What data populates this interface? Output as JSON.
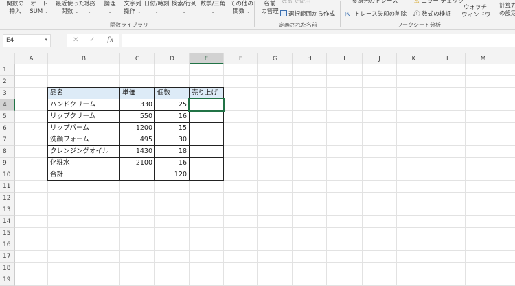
{
  "ribbon": {
    "buttons": [
      {
        "l1": "関数の",
        "l2": "挿入",
        "dd": ""
      },
      {
        "l1": "オート",
        "l2": "SUM",
        "dd": "⌄"
      },
      {
        "l1": "最近使った",
        "l2": "関数",
        "dd": "⌄"
      },
      {
        "l1": "財務",
        "l2": "",
        "dd": "⌄"
      },
      {
        "l1": "論理",
        "l2": "",
        "dd": "⌄"
      },
      {
        "l1": "文字列",
        "l2": "操作",
        "dd": "⌄"
      },
      {
        "l1": "日付/時刻",
        "l2": "",
        "dd": "⌄"
      },
      {
        "l1": "検索/行列",
        "l2": "",
        "dd": "⌄"
      },
      {
        "l1": "数学/三角",
        "l2": "",
        "dd": "⌄"
      },
      {
        "l1": "その他の",
        "l2": "関数",
        "dd": "⌄"
      }
    ],
    "group1": "関数ライブラリ",
    "name_manager": {
      "l1": "名前",
      "l2": "の管理"
    },
    "use_in_formula": "数式で使用",
    "create_from_selection": "選択範囲から作成",
    "group2": "定義された名前",
    "trace_dependents": "参照先のトレース",
    "remove_arrows": "トレース矢印の削除",
    "error_check": "エラー チェック",
    "evaluate_formula": "数式の検証",
    "watch_window": {
      "l1": "ウォッチ",
      "l2": "ウィンドウ"
    },
    "group3": "ワークシート分析",
    "calc_options": {
      "l1": "計算方法",
      "l2": "の設定"
    }
  },
  "formula_bar": {
    "name_box": "E4",
    "cancel": "✕",
    "enter": "✓",
    "fx": "fx",
    "value": ""
  },
  "columns": [
    "A",
    "B",
    "C",
    "D",
    "E",
    "F",
    "G",
    "H",
    "I",
    "J",
    "K",
    "L",
    "M",
    ""
  ],
  "rows": [
    "1",
    "2",
    "3",
    "4",
    "5",
    "6",
    "7",
    "8",
    "9",
    "10",
    "11",
    "12",
    "13",
    "14",
    "15",
    "16",
    "17",
    "18",
    "19"
  ],
  "selected_cell": "E4",
  "table": {
    "headers": [
      "品名",
      "単価",
      "個数",
      "売り上げ"
    ],
    "rows": [
      [
        "ハンドクリーム",
        "330",
        "25",
        ""
      ],
      [
        "リップクリーム",
        "550",
        "16",
        ""
      ],
      [
        "リップバーム",
        "1200",
        "15",
        ""
      ],
      [
        "洗顔フォーム",
        "495",
        "30",
        ""
      ],
      [
        "クレンジングオイル",
        "1430",
        "18",
        ""
      ],
      [
        "化粧水",
        "2100",
        "16",
        ""
      ],
      [
        "合計",
        "",
        "120",
        ""
      ]
    ]
  },
  "colors": {
    "accent": "#217346",
    "header_fill": "#ddebf7"
  }
}
